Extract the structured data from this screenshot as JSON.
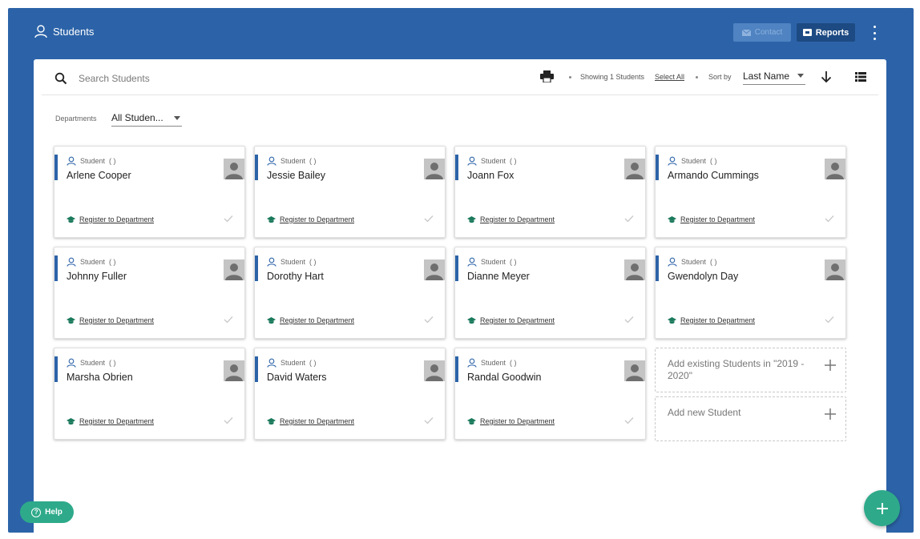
{
  "header": {
    "title": "Students",
    "contact_label": "Contact",
    "reports_label": "Reports"
  },
  "toolbar": {
    "search_placeholder": "Search Students",
    "showing_text": "Showing 1 Students",
    "select_all_label": "Select All",
    "sort_by_label": "Sort by",
    "sort_value": "Last Name"
  },
  "filters": {
    "departments_label": "Departments",
    "departments_value": "All Studen..."
  },
  "students": [
    {
      "role": "Student",
      "role_suffix": "( )",
      "name": "Arlene Cooper",
      "register_label": "Register to Department"
    },
    {
      "role": "Student",
      "role_suffix": "( )",
      "name": "Jessie Bailey",
      "register_label": "Register to Department"
    },
    {
      "role": "Student",
      "role_suffix": "( )",
      "name": "Joann Fox",
      "register_label": "Register to Department"
    },
    {
      "role": "Student",
      "role_suffix": "( )",
      "name": "Armando Cummings",
      "register_label": "Register to Department"
    },
    {
      "role": "Student",
      "role_suffix": "( )",
      "name": "Johnny Fuller",
      "register_label": "Register to Department"
    },
    {
      "role": "Student",
      "role_suffix": "( )",
      "name": "Dorothy Hart",
      "register_label": "Register to Department"
    },
    {
      "role": "Student",
      "role_suffix": "( )",
      "name": "Dianne Meyer",
      "register_label": "Register to Department"
    },
    {
      "role": "Student",
      "role_suffix": "( )",
      "name": "Gwendolyn Day",
      "register_label": "Register to Department"
    },
    {
      "role": "Student",
      "role_suffix": "( )",
      "name": "Marsha Obrien",
      "register_label": "Register to Department"
    },
    {
      "role": "Student",
      "role_suffix": "( )",
      "name": "David Waters",
      "register_label": "Register to Department"
    },
    {
      "role": "Student",
      "role_suffix": "( )",
      "name": "Randal Goodwin",
      "register_label": "Register to Department"
    }
  ],
  "add_existing_label": "Add existing Students in \"2019 - 2020\"",
  "add_new_label": "Add new Student",
  "help_label": "Help",
  "colors": {
    "primary": "#2c63a8",
    "accent": "#2eaa8a"
  }
}
